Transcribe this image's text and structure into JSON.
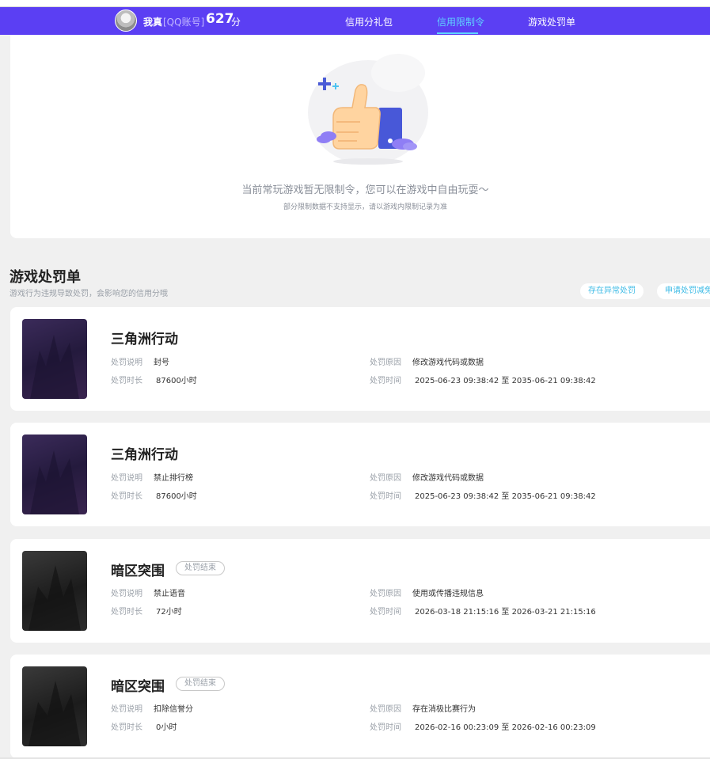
{
  "header": {
    "username": "我真",
    "account_tag": "[QQ账号]",
    "score": "627",
    "score_unit": "分",
    "tabs": [
      {
        "label": "信用分礼包",
        "active": false
      },
      {
        "label": "信用限制令",
        "active": true
      },
      {
        "label": "游戏处罚单",
        "active": false
      }
    ],
    "colors": {
      "bar": "#5b3ff3",
      "active_tab": "#5fd3ff"
    }
  },
  "restriction": {
    "empty_title": "当前常玩游戏暂无限制令，您可以在游戏中自由玩耍～",
    "empty_subtitle": "部分限制数据不支持显示，请以游戏内限制记录为准",
    "illustration_icon": "thumbs-up-icon"
  },
  "penalty_section": {
    "title": "游戏处罚单",
    "subtitle": "游戏行为违规导致处罚，会影响您的信用分哦",
    "buttons": [
      "存在异常处罚",
      "申请处罚减免"
    ],
    "labels": {
      "description": "处罚说明",
      "duration": "处罚时长",
      "reason": "处罚原因",
      "time": "处罚时间"
    },
    "items": [
      {
        "game": "三角洲行动",
        "badge": "",
        "description": "封号",
        "duration": "87600小时",
        "reason": "修改游戏代码或数据",
        "time": "2025-06-23 09:38:42 至 2035-06-21 09:38:42"
      },
      {
        "game": "三角洲行动",
        "badge": "",
        "description": "禁止排行榜",
        "duration": "87600小时",
        "reason": "修改游戏代码或数据",
        "time": "2025-06-23 09:38:42 至 2035-06-21 09:38:42"
      },
      {
        "game": "暗区突围",
        "badge": "处罚结束",
        "description": "禁止语音",
        "duration": "72小时",
        "reason": "使用或传播违规信息",
        "time": "2026-03-18 21:15:16 至 2026-03-21 21:15:16"
      },
      {
        "game": "暗区突围",
        "badge": "处罚结束",
        "description": "扣除信誉分",
        "duration": "0小时",
        "reason": "存在消极比赛行为",
        "time": "2026-02-16 00:23:09 至 2026-02-16 00:23:09"
      }
    ]
  }
}
